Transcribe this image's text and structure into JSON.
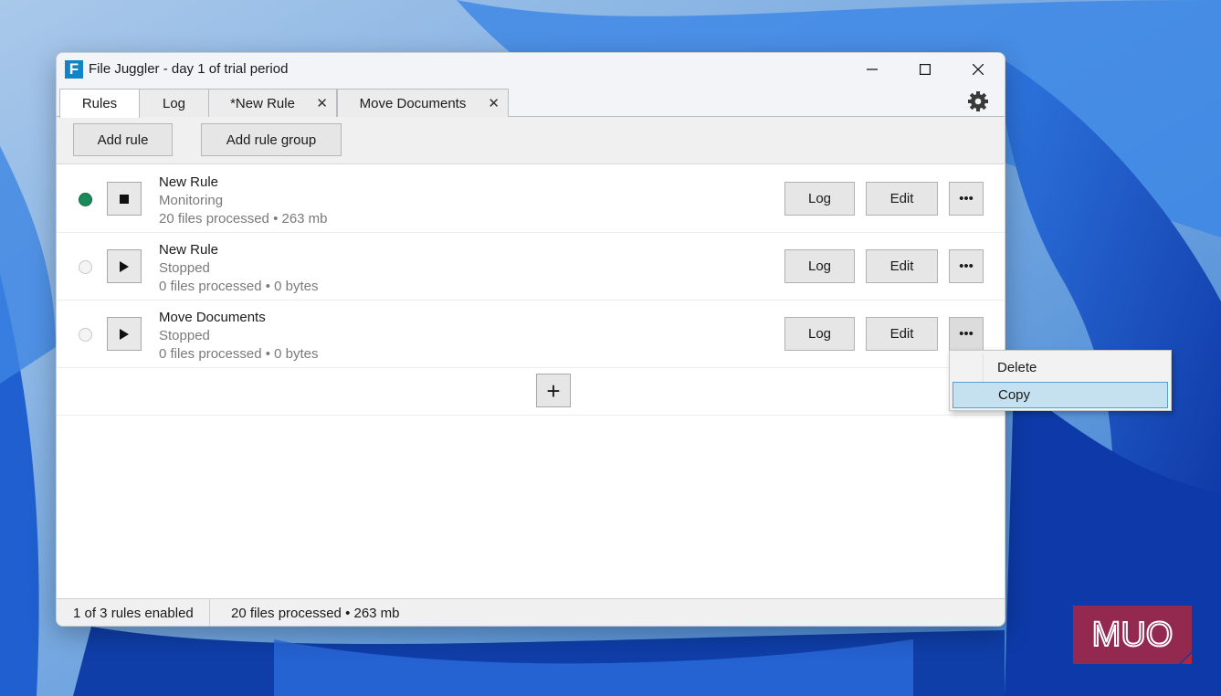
{
  "window": {
    "title": "File Juggler - day 1 of trial period",
    "app_icon_letter": "F"
  },
  "tabs": [
    {
      "label": "Rules",
      "active": true,
      "closable": false
    },
    {
      "label": "Log",
      "active": false,
      "closable": false
    },
    {
      "label": "*New Rule",
      "active": false,
      "closable": true
    },
    {
      "label": "Move Documents",
      "active": false,
      "closable": true
    }
  ],
  "tab_close_glyph": "✕",
  "toolbar": {
    "add_rule_label": "Add rule",
    "add_rule_group_label": "Add rule group"
  },
  "rules": [
    {
      "name": "New Rule",
      "status": "Monitoring",
      "stats": "20 files processed • 263 mb",
      "enabled": true,
      "control": "stop-icon"
    },
    {
      "name": "New Rule",
      "status": "Stopped",
      "stats": "0 files processed • 0 bytes",
      "enabled": false,
      "control": "play-icon"
    },
    {
      "name": "Move Documents",
      "status": "Stopped",
      "stats": "0 files processed • 0 bytes",
      "enabled": false,
      "control": "play-icon"
    }
  ],
  "row_buttons": {
    "log_label": "Log",
    "edit_label": "Edit",
    "more_label": "•••"
  },
  "add_glyph": "+",
  "statusbar": {
    "rules_enabled": "1 of 3 rules enabled",
    "total_stats": "20 files processed • 263 mb"
  },
  "context_menu": {
    "items": [
      {
        "label": "Delete",
        "highlighted": false
      },
      {
        "label": "Copy",
        "highlighted": true
      }
    ]
  },
  "watermark": {
    "text": "MUO"
  },
  "colors": {
    "accent": "#1283c5",
    "enabled_dot": "#1a8a5a",
    "menu_highlight": "#c5e0ef",
    "watermark": "#c8232c"
  }
}
